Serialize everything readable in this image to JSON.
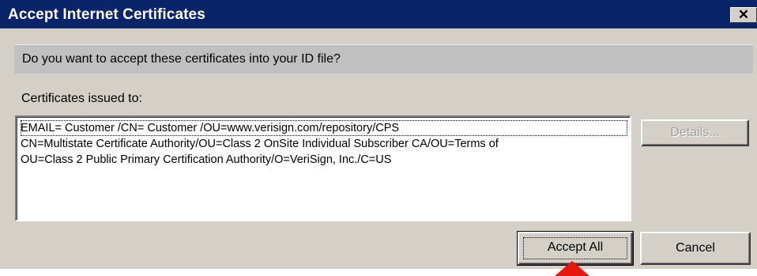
{
  "window": {
    "title": "Accept Internet Certificates",
    "close_glyph": "✕"
  },
  "question": "Do you want to accept these certificates into your ID file?",
  "issued_label": "Certificates issued to:",
  "certificates": [
    "EMAIL=           Customer        /CN= Customer       /OU=www.verisign.com/repository/CPS",
    "CN=Multistate Certificate Authority/OU=Class 2 OnSite Individual Subscriber CA/OU=Terms of",
    "OU=Class 2 Public Primary Certification Authority/O=VeriSign, Inc./C=US"
  ],
  "buttons": {
    "details": "Details...",
    "accept_all": "Accept All",
    "cancel": "Cancel"
  },
  "colors": {
    "titlebar": "#0a246a",
    "dialog_face": "#d4d0c8",
    "pointer_arrow": "#e8170d"
  },
  "icons": {
    "close": "close-icon",
    "pointer": "red-arrow-pointer-icon"
  }
}
